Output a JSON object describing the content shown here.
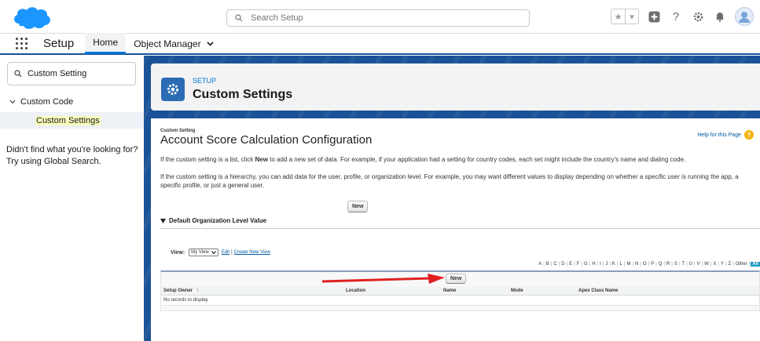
{
  "header": {
    "search_placeholder": "Search Setup",
    "icons": [
      "favorites-star-icon",
      "favorites-list-icon",
      "global-actions-icon",
      "help-icon",
      "setup-gear-icon",
      "notifications-bell-icon",
      "user-avatar"
    ]
  },
  "nav": {
    "app_name": "Setup",
    "tabs": [
      {
        "label": "Home",
        "active": true
      },
      {
        "label": "Object Manager",
        "active": false
      }
    ]
  },
  "sidebar": {
    "quick_find_value": "Custom Setting",
    "tree_parent": "Custom Code",
    "tree_child": "Custom Settings",
    "help_text": "Didn't find what you're looking for? Try using Global Search."
  },
  "page_header": {
    "eyebrow": "SETUP",
    "title": "Custom Settings"
  },
  "content": {
    "label": "Custom Setting",
    "title": "Account Score Calculation Configuration",
    "help_link": "Help for this Page",
    "para1_before": "If the custom setting is a list, click ",
    "para1_bold": "New",
    "para1_after": " to add a new set of data. For example, if your application had a setting for country codes, each set might include the country's name and dialing code.",
    "para2": "If the custom setting is a hierarchy, you can add data for the user, profile, or organization level. For example, you may want different values to display depending on whether a specific user is running the app, a specific profile, or just a general user.",
    "new_button": "New",
    "section_title": "Default Organization Level Value",
    "view_label": "View:",
    "view_value": "My View",
    "edit_link": "Edit",
    "create_view_link": "Create New View",
    "alphabet": [
      "A",
      "B",
      "C",
      "D",
      "E",
      "F",
      "G",
      "H",
      "I",
      "J",
      "K",
      "L",
      "M",
      "N",
      "O",
      "P",
      "Q",
      "R",
      "S",
      "T",
      "U",
      "V",
      "W",
      "X",
      "Y",
      "Z",
      "Other",
      "All"
    ],
    "alphabet_active": "All",
    "list_new_button": "New",
    "columns": [
      "Setup Owner",
      "Location",
      "Name",
      "Mode",
      "Apex Class Name"
    ],
    "sort_indicator": "↑",
    "empty_text": "No records to display."
  },
  "colors": {
    "brand_blue": "#0176d3",
    "main_background": "#1b5297",
    "annotation_arrow": "#e02020",
    "alpha_active": "#1797c0"
  }
}
